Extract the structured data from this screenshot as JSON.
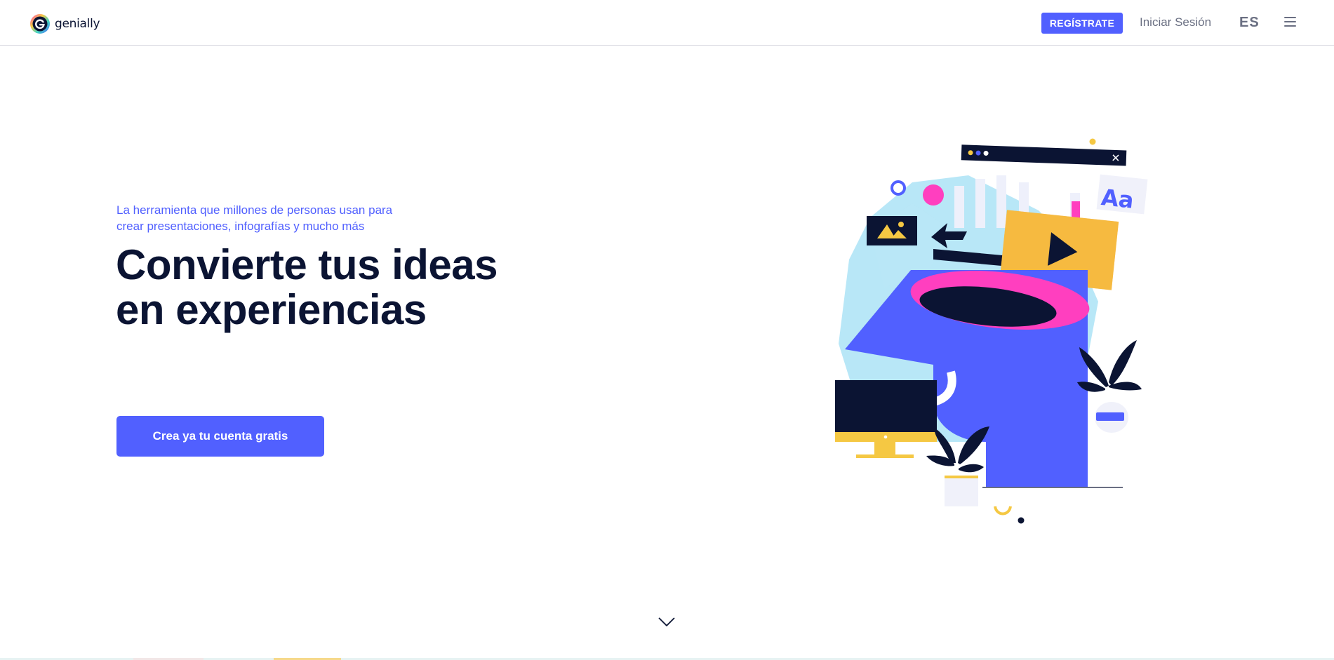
{
  "header": {
    "logo_text": "genially",
    "logo_icon": "genially-logo-icon",
    "register_label": "REGÍSTRATE",
    "login_label": "Iniciar Sesión",
    "language": "ES",
    "menu_icon": "hamburger-menu-icon"
  },
  "hero": {
    "tagline_line1": "La herramienta que millones de personas usan para",
    "tagline_line2": "crear presentaciones, infografías y mucho más",
    "headline_line1": "Convierte tus ideas",
    "headline_line2": "en experiencias",
    "cta_label": "Crea ya tu cuenta gratis",
    "illustration": "head-illustration"
  },
  "scroll_icon": "chevron-down-icon",
  "colors": {
    "brand": "#5160ff",
    "navy": "#0b1433",
    "pink": "#ff3fbf",
    "yellow": "#f5c843",
    "cyan": "#7dd3f0",
    "muted": "#6a6f82"
  }
}
